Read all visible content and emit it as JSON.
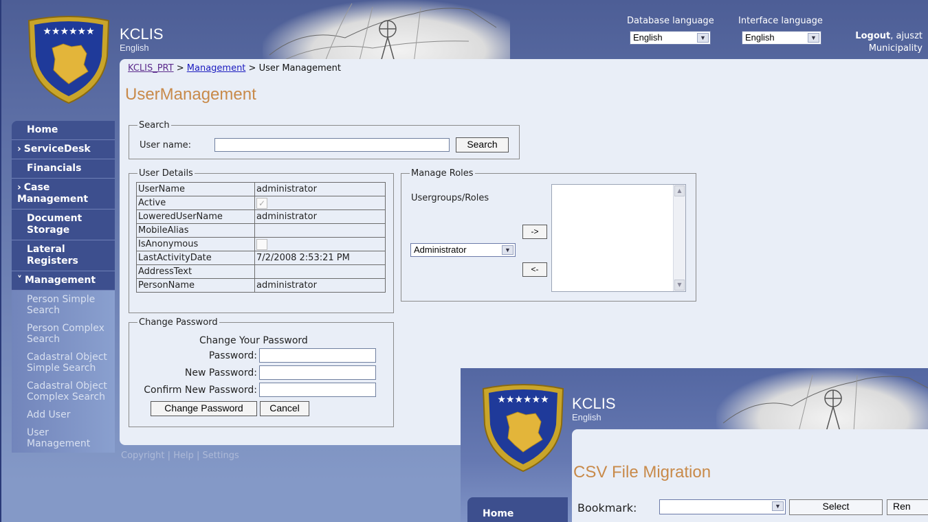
{
  "header": {
    "app_title": "KCLIS",
    "app_subtitle": "English",
    "db_language_label": "Database language",
    "db_language_value": "English",
    "ui_language_label": "Interface language",
    "ui_language_value": "English",
    "logout_label": "Logout",
    "user_suffix": ", ajuszt",
    "municipality": "Municipality"
  },
  "breadcrumb": {
    "root": "KCLIS_PRT",
    "sep1": " > ",
    "management": "Management",
    "sep2": " > ",
    "current": "User Management"
  },
  "page_title": "UserManagement",
  "search": {
    "legend": "Search",
    "user_name_label": "User name:",
    "user_name_value": "",
    "search_button": "Search"
  },
  "user_details": {
    "legend": "User Details",
    "rows": [
      {
        "key": "UserName",
        "value": "administrator",
        "type": "text"
      },
      {
        "key": "Active",
        "value": "✓",
        "type": "check"
      },
      {
        "key": "LoweredUserName",
        "value": "administrator",
        "type": "text"
      },
      {
        "key": "MobileAlias",
        "value": "",
        "type": "text"
      },
      {
        "key": "IsAnonymous",
        "value": "",
        "type": "check"
      },
      {
        "key": "LastActivityDate",
        "value": "7/2/2008 2:53:21 PM",
        "type": "text"
      },
      {
        "key": "AddressText",
        "value": "",
        "type": "text"
      },
      {
        "key": "PersonName",
        "value": "administrator",
        "type": "text"
      }
    ]
  },
  "manage_roles": {
    "legend": "Manage Roles",
    "label": "Usergroups/Roles",
    "selected_role": "Administrator",
    "add_button": "->",
    "remove_button": "<-"
  },
  "change_password": {
    "legend": "Change Password",
    "heading": "Change Your Password",
    "password_label": "Password:",
    "new_password_label": "New Password:",
    "confirm_label": "Confirm New Password:",
    "change_button": "Change Password",
    "cancel_button": "Cancel"
  },
  "sidebar": {
    "items": [
      {
        "label": "Home",
        "prefix": ""
      },
      {
        "label": "ServiceDesk",
        "prefix": "›"
      },
      {
        "label": "Financials",
        "prefix": ""
      },
      {
        "label": "Case Management",
        "prefix": "›"
      },
      {
        "label": "Document Storage",
        "prefix": ""
      },
      {
        "label": "Lateral Registers",
        "prefix": ""
      },
      {
        "label": "Management",
        "prefix": "˅"
      }
    ],
    "subitems": [
      "Person Simple Search",
      "Person Complex Search",
      "Cadastral Object Simple Search",
      "Cadastral Object Complex Search",
      "Add User",
      "User Management"
    ]
  },
  "footer": {
    "copyright": "Copyright",
    "help": "Help",
    "settings": "Settings",
    "sep": " | "
  },
  "second_window": {
    "app_title": "KCLIS",
    "app_subtitle": "English",
    "page_title": "CSV File Migration",
    "bookmark_label": "Bookmark:",
    "select_button": "Select",
    "rename_button": "Ren",
    "home": "Home"
  },
  "colors": {
    "title_orange": "#c88a4a",
    "nav_blue": "#3d4f8e",
    "content_bg": "#e9eef7"
  }
}
